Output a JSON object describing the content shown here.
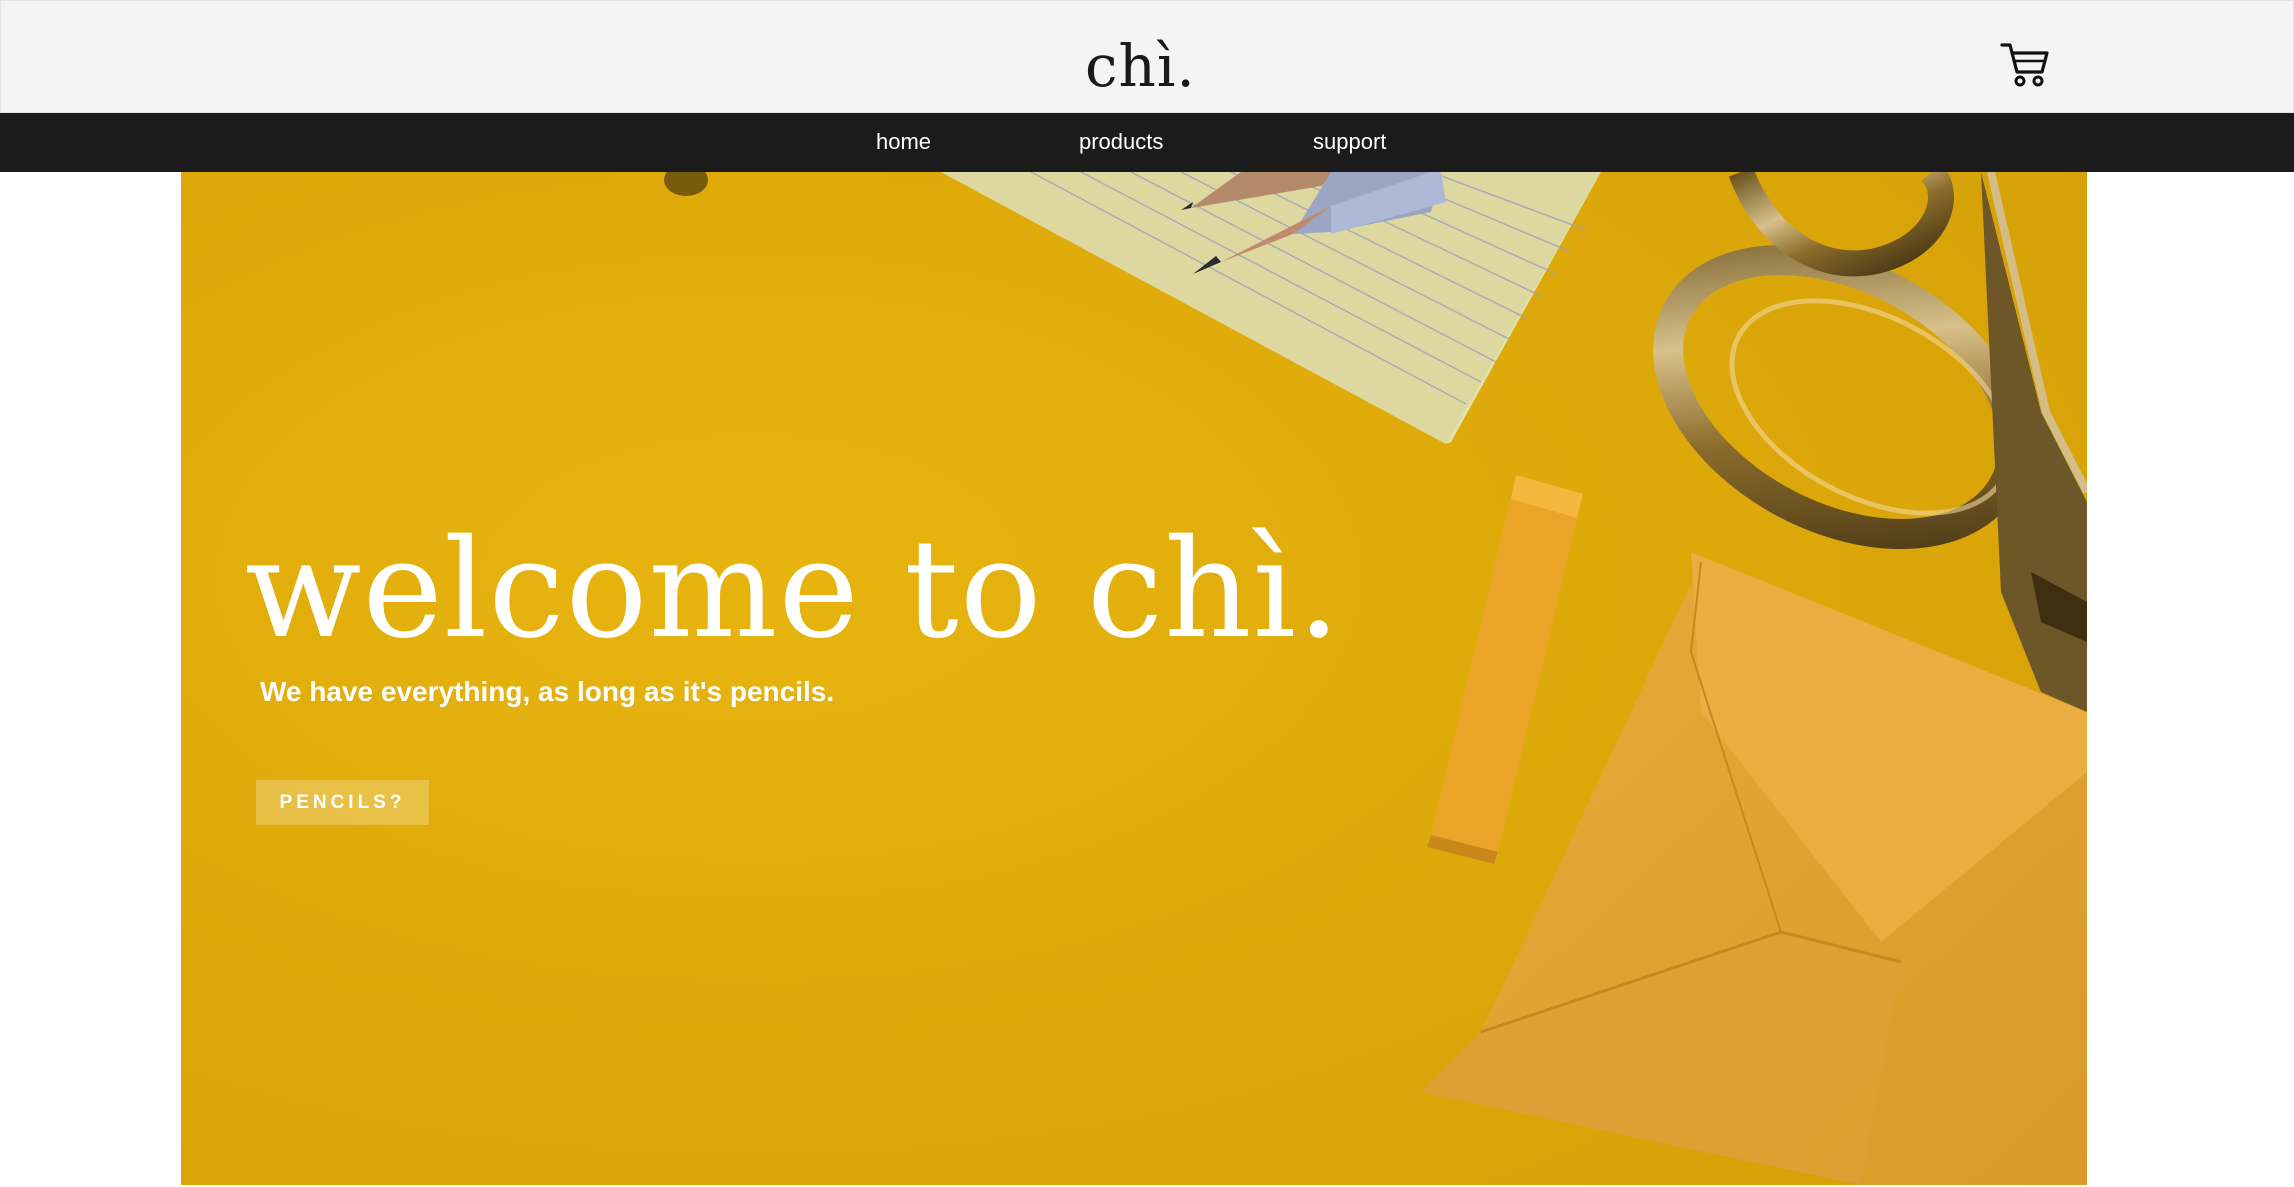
{
  "header": {
    "logo_text": "chì.",
    "cart_icon": "shopping-cart-icon"
  },
  "nav": {
    "items": [
      {
        "label": "home"
      },
      {
        "label": "products"
      },
      {
        "label": "support"
      }
    ]
  },
  "hero": {
    "title": "welcome to chì.",
    "subtitle": "We have everything, as long as it's pencils.",
    "button_label": "PENCILS?",
    "background_color": "#e0ad0b"
  },
  "colors": {
    "header_bg": "#f4f4f4",
    "nav_bg": "#1b1b1b",
    "accent_yellow": "#e0ad0b",
    "text_light": "#ffffff"
  }
}
